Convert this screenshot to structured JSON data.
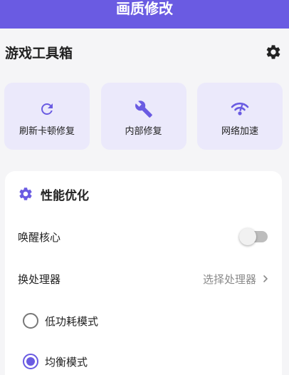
{
  "header": {
    "title": "画质修改"
  },
  "section": {
    "title": "游戏工具箱",
    "settings_icon": "gear-icon"
  },
  "tools": [
    {
      "label": "刷新卡顿修复",
      "icon": "refresh-icon"
    },
    {
      "label": "内部修复",
      "icon": "wrench-icon"
    },
    {
      "label": "网络加速",
      "icon": "network-icon"
    }
  ],
  "performance": {
    "title": "性能优化",
    "icon": "gear-icon",
    "wake_core": {
      "label": "唤醒核心",
      "enabled": false
    },
    "processor": {
      "label": "换处理器",
      "value": "选择处理器"
    },
    "modes": [
      {
        "label": "低功耗模式",
        "selected": false
      },
      {
        "label": "均衡模式",
        "selected": true
      }
    ]
  },
  "colors": {
    "accent": "#6a5be2",
    "card_bg": "#ebe9fb",
    "page_bg": "#f5f5f7"
  }
}
